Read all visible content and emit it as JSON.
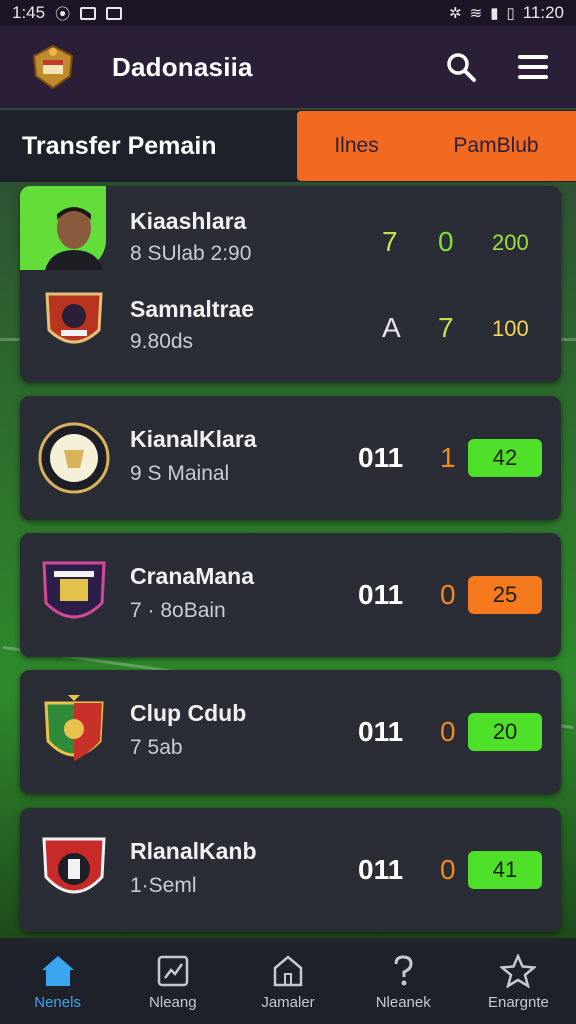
{
  "status_bar": {
    "time": "1:45",
    "clock": "11:20"
  },
  "header": {
    "app_title": "Dadonasiia"
  },
  "tabs": {
    "section_title": "Transfer Pemain",
    "items": [
      {
        "label": "Ilnes"
      },
      {
        "label": "PamBlub"
      }
    ]
  },
  "featured_card": {
    "rows": [
      {
        "name": "Kiaashlara",
        "sub": "8 SUlab 2:90",
        "v1": "7",
        "v2": "0",
        "v3": "200"
      },
      {
        "name": "Samnaltrae",
        "sub": "9.80ds",
        "v1": "A",
        "v2": "7",
        "v3": "100"
      }
    ]
  },
  "list": [
    {
      "name": "KianalKlara",
      "sub": "9 S Mainal",
      "v1": "011",
      "v2": "1",
      "badge": "42",
      "badge_color": "#4fe02a"
    },
    {
      "name": "CranaMana",
      "sub": "7 · 8oBain",
      "v1": "011",
      "v2": "0",
      "badge": "25",
      "badge_color": "#f47a1d"
    },
    {
      "name": "Clup Cdub",
      "sub": "7 5ab",
      "v1": "011",
      "v2": "0",
      "badge": "20",
      "badge_color": "#4fe02a"
    },
    {
      "name": "RlanalKanb",
      "sub": "1·Seml",
      "v1": "011",
      "v2": "0",
      "badge": "41",
      "badge_color": "#4fe02a"
    }
  ],
  "bottom_nav": [
    {
      "label": "Nenels",
      "icon": "home-icon"
    },
    {
      "label": "Nleang",
      "icon": "chart-icon"
    },
    {
      "label": "Jamaler",
      "icon": "house-icon"
    },
    {
      "label": "Nleanek",
      "icon": "question-icon"
    },
    {
      "label": "Enargnte",
      "icon": "star-icon"
    }
  ],
  "colors": {
    "accent_orange": "#f26a1f",
    "accent_green": "#4fe02a",
    "nav_active": "#3aa6f0"
  }
}
